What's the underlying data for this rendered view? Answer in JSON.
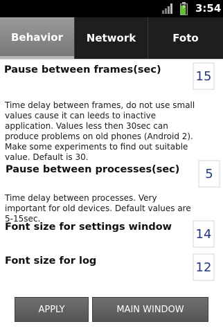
{
  "status_bar": {
    "time": "3:54",
    "icons": [
      "signal-icon",
      "battery-charging-icon"
    ]
  },
  "tabs": [
    {
      "label": "Behavior",
      "active": true
    },
    {
      "label": "Network",
      "active": false
    },
    {
      "label": "Foto",
      "active": false
    }
  ],
  "settings": {
    "pause_frames": {
      "label": "Pause between frames(sec)",
      "value": "15",
      "description": "Time delay between frames, do not use small values cause it can leeds to inactive application. Values less then 30sec can produce problems on old phones (Android 2). Make some experiments to find out suitable value. Default is 30."
    },
    "pause_processes": {
      "label": "Pause between processes(sec)",
      "value": "5",
      "description": "Time delay between processes. Very important for old devices. Default values are 5-15sec."
    },
    "font_settings": {
      "label": "Font size for settings window",
      "value": "14"
    },
    "font_log": {
      "label": "Font size for log",
      "value": "12"
    }
  },
  "buttons": {
    "apply": "APPLY",
    "main_window": "MAIN WINDOW"
  },
  "colors": {
    "active_tab": "#8a8a8a",
    "tab_bar": "#1e1e1e",
    "battery": "#62c12a",
    "input_text": "#223a7a"
  }
}
